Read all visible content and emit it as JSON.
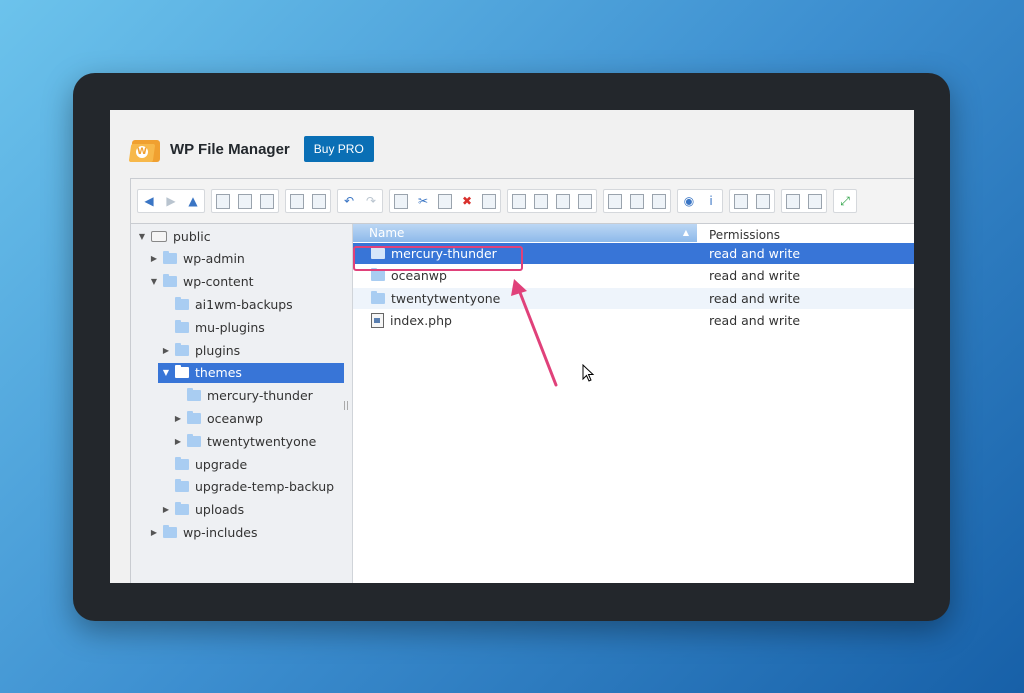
{
  "app": {
    "title": "WP File Manager",
    "buy_label": "Buy PRO"
  },
  "colors": {
    "accent": "#3875d7",
    "highlight": "#e0417a",
    "buy_button": "#0a6fb5"
  },
  "toolbar": {
    "groups": [
      [
        "arrow-left-icon",
        "arrow-right-icon",
        "arrow-up-icon"
      ],
      [
        "reload-icon",
        "new-file-icon",
        "save-icon"
      ],
      [
        "open-icon",
        "download-icon"
      ],
      [
        "undo-icon",
        "redo-icon"
      ],
      [
        "copy-icon",
        "cut-icon",
        "paste-icon",
        "delete-icon",
        "empty-icon"
      ],
      [
        "duplicate-icon",
        "rename-icon",
        "edit-icon",
        "resize-icon"
      ],
      [
        "select-all-icon",
        "select-none-icon",
        "invert-select-icon"
      ],
      [
        "preview-icon",
        "info-icon"
      ],
      [
        "extract-icon",
        "archive-icon"
      ],
      [
        "icons-view-icon",
        "list-view-icon"
      ],
      [
        "fullscreen-icon"
      ]
    ]
  },
  "tree": [
    {
      "label": "public",
      "level": 0,
      "arrow": "down",
      "icon": "drive"
    },
    {
      "label": "wp-admin",
      "level": 1,
      "arrow": "right"
    },
    {
      "label": "wp-content",
      "level": 1,
      "arrow": "down"
    },
    {
      "label": "ai1wm-backups",
      "level": 2,
      "arrow": ""
    },
    {
      "label": "mu-plugins",
      "level": 2,
      "arrow": ""
    },
    {
      "label": "plugins",
      "level": 2,
      "arrow": "right"
    },
    {
      "label": "themes",
      "level": 2,
      "arrow": "down",
      "selected": true
    },
    {
      "label": "mercury-thunder",
      "level": 3,
      "arrow": ""
    },
    {
      "label": "oceanwp",
      "level": 3,
      "arrow": "right"
    },
    {
      "label": "twentytwentyone",
      "level": 3,
      "arrow": "right"
    },
    {
      "label": "upgrade",
      "level": 2,
      "arrow": ""
    },
    {
      "label": "upgrade-temp-backup",
      "level": 2,
      "arrow": ""
    },
    {
      "label": "uploads",
      "level": 2,
      "arrow": "right"
    },
    {
      "label": "wp-includes",
      "level": 1,
      "arrow": "right"
    }
  ],
  "columns": {
    "name": "Name",
    "permissions": "Permissions"
  },
  "files": [
    {
      "name": "mercury-thunder",
      "permissions": "read and write",
      "type": "folder",
      "selected": true
    },
    {
      "name": "oceanwp",
      "permissions": "read and write",
      "type": "folder"
    },
    {
      "name": "twentytwentyone",
      "permissions": "read and write",
      "type": "folder"
    },
    {
      "name": "index.php",
      "permissions": "read and write",
      "type": "file"
    }
  ]
}
